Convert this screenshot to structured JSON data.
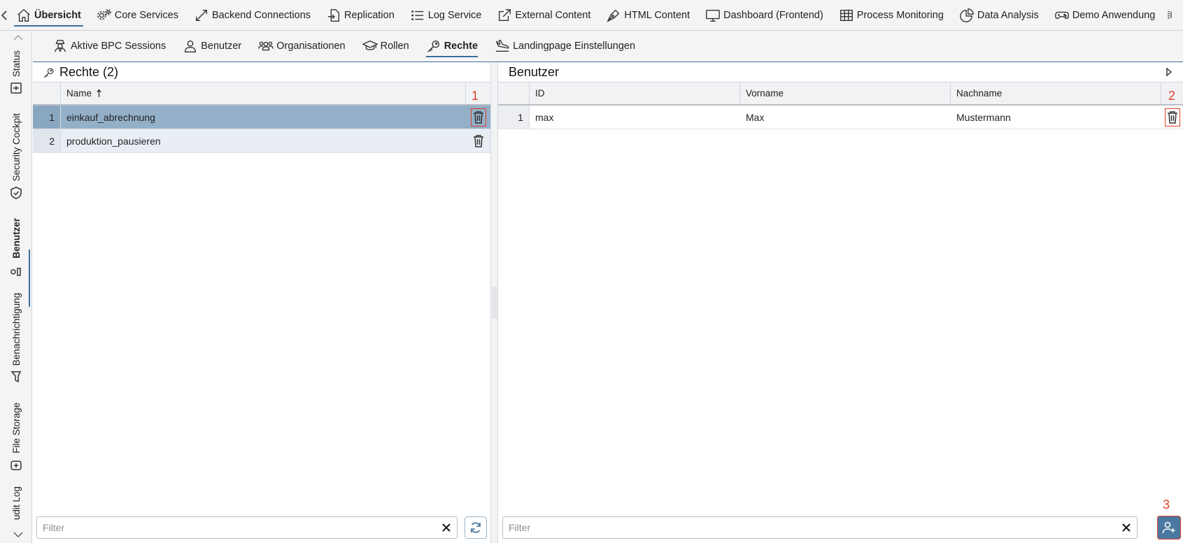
{
  "topnav": {
    "items": [
      {
        "label": "Übersicht",
        "icon": "home-icon"
      },
      {
        "label": "Core Services",
        "icon": "gears-icon"
      },
      {
        "label": "Backend Connections",
        "icon": "expand-arrows-icon"
      },
      {
        "label": "Replication",
        "icon": "file-import-icon"
      },
      {
        "label": "Log Service",
        "icon": "list-icon"
      },
      {
        "label": "External Content",
        "icon": "external-link-icon"
      },
      {
        "label": "HTML Content",
        "icon": "pen-nib-icon"
      },
      {
        "label": "Dashboard (Frontend)",
        "icon": "monitor-icon"
      },
      {
        "label": "Process Monitoring",
        "icon": "table-icon"
      },
      {
        "label": "Data Analysis",
        "icon": "pie-chart-icon"
      },
      {
        "label": "Demo Anwendung",
        "icon": "gamepad-icon"
      }
    ]
  },
  "sidebar": {
    "items": [
      {
        "label": "Status",
        "icon": "status-icon"
      },
      {
        "label": "Security Cockpit",
        "icon": "shield-icon"
      },
      {
        "label": "Benutzer",
        "icon": "users-icon"
      },
      {
        "label": "Benachrichtigung",
        "icon": "megaphone-icon"
      },
      {
        "label": "File Storage",
        "icon": "hdd-icon"
      },
      {
        "label": "udit Log",
        "icon": ""
      }
    ]
  },
  "subnav": {
    "items": [
      {
        "label": "Aktive BPC Sessions",
        "icon": "user-secret-icon"
      },
      {
        "label": "Benutzer",
        "icon": "user-icon"
      },
      {
        "label": "Organisationen",
        "icon": "people-group-icon"
      },
      {
        "label": "Rollen",
        "icon": "graduation-cap-icon"
      },
      {
        "label": "Rechte",
        "icon": "key-icon"
      },
      {
        "label": "Landingpage Einstellungen",
        "icon": "plane-landing-icon"
      }
    ]
  },
  "left_panel": {
    "title": "Rechte (2)",
    "column_name": "Name",
    "rows": [
      {
        "num": "1",
        "name": "einkauf_abrechnung"
      },
      {
        "num": "2",
        "name": "produktion_pausieren"
      }
    ],
    "badge": "1",
    "filter_placeholder": "Filter"
  },
  "right_panel": {
    "title": "Benutzer",
    "columns": [
      "ID",
      "Vorname",
      "Nachname"
    ],
    "rows": [
      {
        "num": "1",
        "id": "max",
        "vorname": "Max",
        "nachname": "Mustermann"
      }
    ],
    "badge_delete": "2",
    "badge_add": "3",
    "filter_placeholder": "Filter"
  },
  "colors": {
    "accent": "#3b6e9a",
    "selected_row": "#94b0c9",
    "annotation": "#e0402a"
  }
}
